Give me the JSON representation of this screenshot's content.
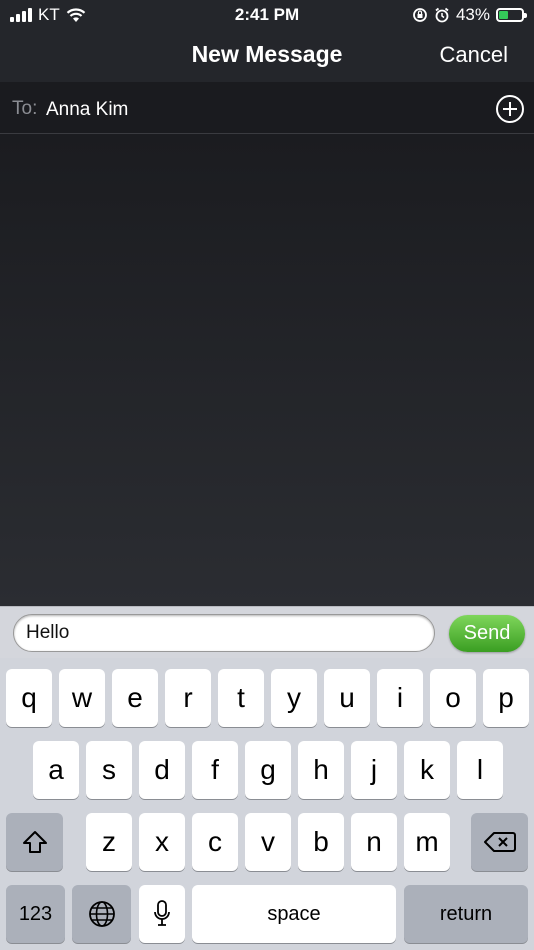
{
  "status_bar": {
    "carrier": "KT",
    "time": "2:41 PM",
    "battery_percent": "43%",
    "battery_level": 0.43
  },
  "nav_bar": {
    "title": "New Message",
    "cancel_label": "Cancel"
  },
  "recipient": {
    "label": "To:",
    "value": "Anna Kim"
  },
  "compose": {
    "text": "Hello",
    "send_label": "Send"
  },
  "keyboard": {
    "row1": [
      "q",
      "w",
      "e",
      "r",
      "t",
      "y",
      "u",
      "i",
      "o",
      "p"
    ],
    "row2": [
      "a",
      "s",
      "d",
      "f",
      "g",
      "h",
      "j",
      "k",
      "l"
    ],
    "row3": [
      "z",
      "x",
      "c",
      "v",
      "b",
      "n",
      "m"
    ],
    "numbers_label": "123",
    "space_label": "space",
    "return_label": "return"
  },
  "colors": {
    "send_green": "#4cb82c",
    "caret_blue": "#2f6bf0",
    "battery_green": "#34c759"
  }
}
